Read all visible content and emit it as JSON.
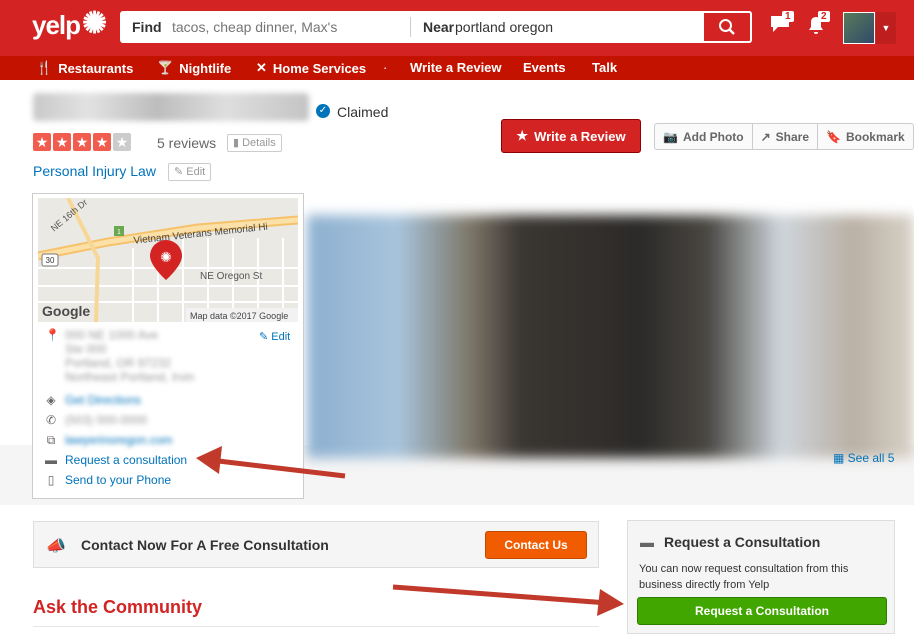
{
  "header": {
    "logo": "yelp",
    "find_label": "Find",
    "find_placeholder": "tacos, cheap dinner, Max's",
    "near_label": "Near",
    "near_value": "portland oregon",
    "messages_count": "1",
    "notifications_count": "2"
  },
  "nav": {
    "restaurants": "Restaurants",
    "nightlife": "Nightlife",
    "home_services": "Home Services",
    "sep": "·",
    "write_review": "Write a Review",
    "events": "Events",
    "talk": "Talk"
  },
  "business": {
    "claimed": "Claimed",
    "rating": 4,
    "reviews": "5 reviews",
    "details": "Details",
    "category": "Personal Injury Law",
    "edit": "Edit"
  },
  "actions": {
    "write_review": "Write a Review",
    "add_photo": "Add Photo",
    "share": "Share",
    "bookmark": "Bookmark"
  },
  "map": {
    "street1": "NE 16th Dr",
    "street2": "Vietnam Veterans Memorial Hi",
    "street3": "NE Oregon St",
    "route": "30",
    "attribution": "Map data ©2017 Google",
    "google": "Google"
  },
  "info": {
    "edit": "Edit",
    "address_lines": [
      "000 NE 1000 Ave",
      "Ste 000",
      "Portland, OR 97232",
      "Northeast Portland, Irvin"
    ],
    "directions": "Get Directions",
    "phone": "(503) 000-0000",
    "website": "lawyerinoregon.com",
    "request_consultation": "Request a consultation",
    "send_to_phone": "Send to your Phone"
  },
  "photos": {
    "see_all": "See all 5"
  },
  "contact": {
    "title": "Contact Now For A Free Consultation",
    "button": "Contact Us"
  },
  "community": {
    "title": "Ask the Community"
  },
  "consultation": {
    "title": "Request a Consultation",
    "text": "You can now request consultation from this business directly from Yelp",
    "button": "Request a Consultation"
  },
  "colors": {
    "brand_red": "#d32323",
    "nav_red": "#c41200",
    "link_blue": "#0073bb",
    "orange": "#f15c00",
    "green": "#41a700",
    "annotation_arrow": "#c0392b"
  }
}
